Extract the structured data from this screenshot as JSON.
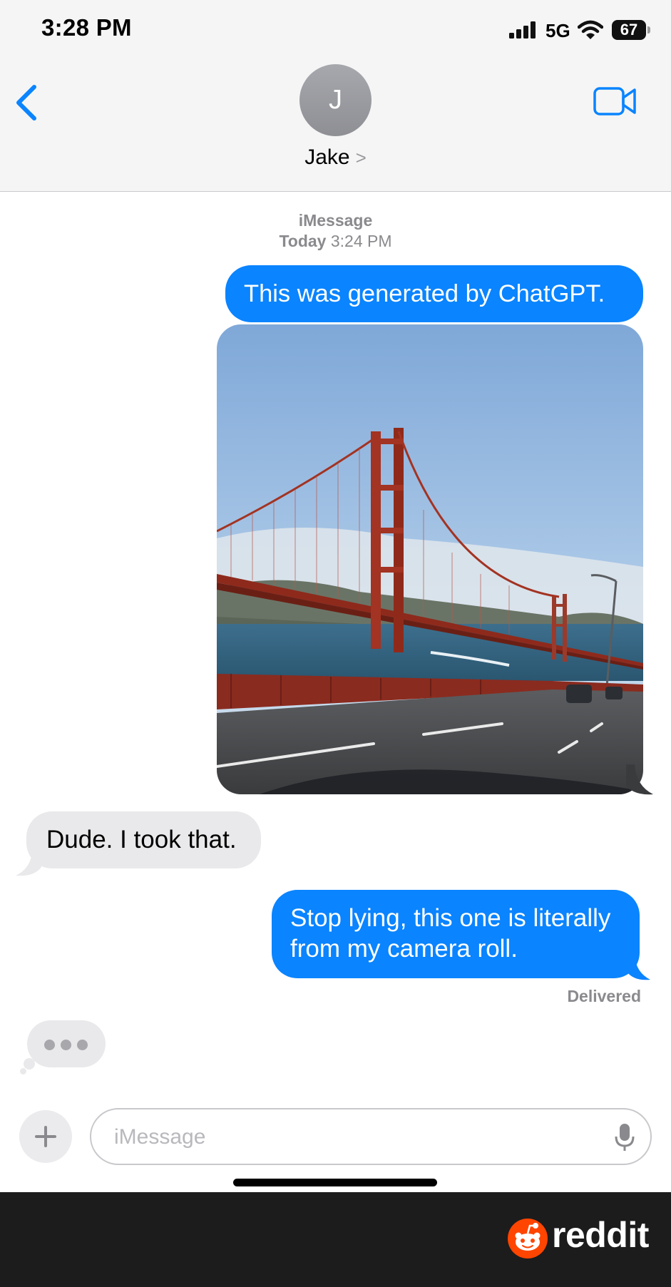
{
  "status_bar": {
    "time": "3:28 PM",
    "network": "5G",
    "battery": "67",
    "icons": [
      "signal-bars-icon",
      "wifi-icon",
      "battery-icon"
    ]
  },
  "header": {
    "back_icon": "chevron-left-icon",
    "avatar_initial": "J",
    "contact_name": "Jake",
    "contact_chevron": ">",
    "video_icon": "video-camera-icon"
  },
  "thread": {
    "service": "iMessage",
    "day": "Today",
    "time": "3:24 PM",
    "messages": [
      {
        "from": "me",
        "type": "text",
        "text": "This was generated by ChatGPT."
      },
      {
        "from": "me",
        "type": "image",
        "description_icon": "golden-gate-bridge-photo"
      },
      {
        "from": "them",
        "type": "text",
        "text": "Dude. I took that."
      },
      {
        "from": "me",
        "type": "text",
        "text": "Stop lying, this one is literally from my camera roll."
      }
    ],
    "receipt": "Delivered",
    "typing_indicator": true
  },
  "composer": {
    "plus_icon": "plus-icon",
    "placeholder": "iMessage",
    "mic_icon": "microphone-icon"
  },
  "footer": {
    "brand": "reddit"
  },
  "colors": {
    "sent_bubble": "#0a84ff",
    "received_bubble": "#e9e9eb",
    "accent": "#0a84ff",
    "reddit_orange": "#ff4500"
  }
}
